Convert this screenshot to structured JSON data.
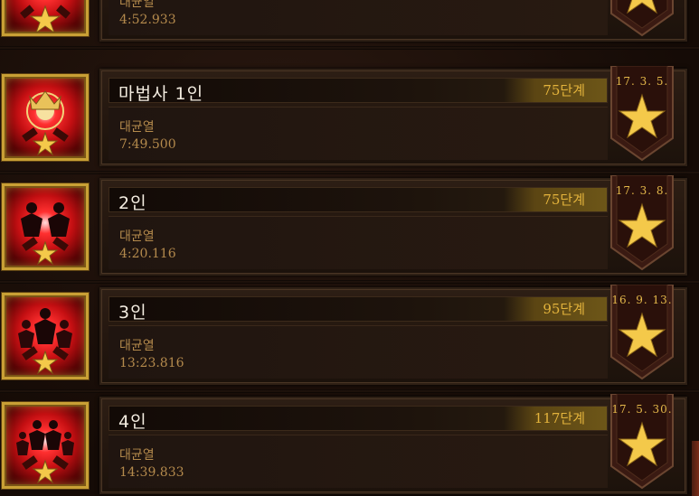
{
  "rows": [
    {
      "title": "",
      "tier": "",
      "rift_label": "대균열",
      "time": "4:52.933",
      "date": "",
      "icon": "crown-skull-icon"
    },
    {
      "title": "마법사 1인",
      "tier": "75단계",
      "rift_label": "대균열",
      "time": "7:49.500",
      "date": "17. 3. 5.",
      "icon": "crown-skull-icon"
    },
    {
      "title": "2인",
      "tier": "75단계",
      "rift_label": "대균열",
      "time": "4:20.116",
      "date": "17. 3. 8.",
      "icon": "two-heroes-icon"
    },
    {
      "title": "3인",
      "tier": "95단계",
      "rift_label": "대균열",
      "time": "13:23.816",
      "date": "16. 9. 13.",
      "icon": "three-heroes-icon"
    },
    {
      "title": "4인",
      "tier": "117단계",
      "rift_label": "대균열",
      "time": "14:39.833",
      "date": "17. 5. 30.",
      "icon": "four-heroes-icon"
    }
  ],
  "colors": {
    "gold": "#e4b84a",
    "tier_text": "#e3b33c",
    "muted_text": "#b48a4c",
    "title_text": "#f3ece0",
    "badge_red": "#c40f12"
  }
}
